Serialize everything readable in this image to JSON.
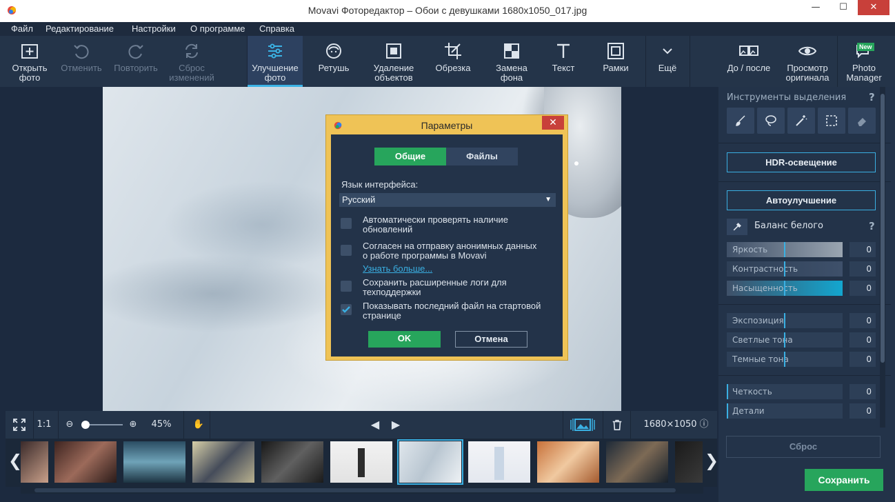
{
  "window": {
    "title": "Movavi Фоторедактор – Обои с девушками 1680x1050_017.jpg",
    "minimize": "—",
    "maximize": "☐",
    "close": "✕"
  },
  "menu": [
    "Файл",
    "Редактирование",
    "Настройки",
    "О программе",
    "Справка"
  ],
  "toolbar": {
    "open": [
      "Открыть",
      "фото"
    ],
    "undo": "Отменить",
    "redo": "Повторить",
    "reset_changes": [
      "Сброс",
      "изменений"
    ],
    "enhance": [
      "Улучшение",
      "фото"
    ],
    "retouch": "Ретушь",
    "remove_objects": [
      "Удаление",
      "объектов"
    ],
    "crop": "Обрезка",
    "replace_bg": [
      "Замена",
      "фона"
    ],
    "text": "Текст",
    "frames": "Рамки",
    "more": "Ещё",
    "before_after": "До / после",
    "view_original": [
      "Просмотр",
      "оригинала"
    ],
    "photo_manager": [
      "Photo",
      "Manager"
    ],
    "new_badge": "New"
  },
  "right_panel": {
    "selection_tools": "Инструменты выделения",
    "help": "?",
    "hdr": "HDR-освещение",
    "auto": "Автоулучшение",
    "white_balance": "Баланс белого",
    "sliders": [
      {
        "label": "Яркость",
        "value": "0"
      },
      {
        "label": "Контрастность",
        "value": "0"
      },
      {
        "label": "Насыщенность",
        "value": "0"
      },
      {
        "label": "Экспозиция",
        "value": "0"
      },
      {
        "label": "Светлые тона",
        "value": "0"
      },
      {
        "label": "Темные тона",
        "value": "0"
      },
      {
        "label": "Четкость",
        "value": "0"
      },
      {
        "label": "Детали",
        "value": "0"
      }
    ],
    "reset": "Сброс",
    "save": "Сохранить"
  },
  "bottombar": {
    "one_to_one": "1:1",
    "zoom": "45%",
    "dimensions": "1680×1050"
  },
  "dialog": {
    "title": "Параметры",
    "close": "✕",
    "tab_general": "Общие",
    "tab_files": "Файлы",
    "lang_label": "Язык интерфейса:",
    "lang_value": "Русский",
    "opt1": [
      "Автоматически проверять наличие",
      "обновлений"
    ],
    "opt2": [
      "Согласен на отправку анонимных данных",
      "о работе программы в Movavi"
    ],
    "learn_more": "Узнать больше...",
    "opt3": [
      "Сохранить расширенные логи для",
      "техподдержки"
    ],
    "opt4": [
      "Показывать последний файл на стартовой",
      "странице"
    ],
    "ok": "OK",
    "cancel": "Отмена"
  },
  "colors": {
    "accent": "#3ab0e3",
    "green": "#27a55c",
    "dialog_frame": "#efc356",
    "panel": "#233349"
  }
}
